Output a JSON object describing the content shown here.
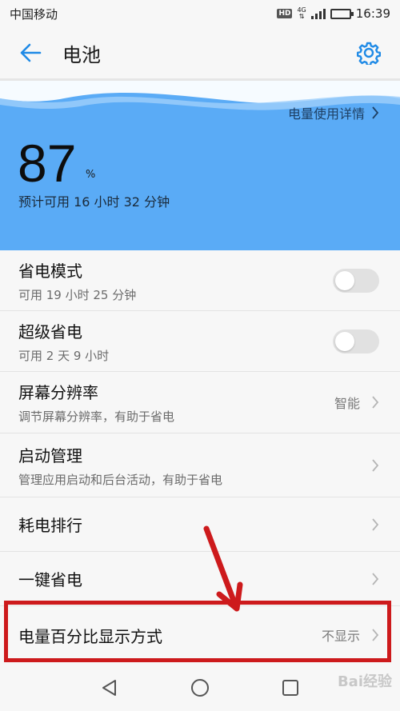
{
  "status_bar": {
    "carrier": "中国移动",
    "hd": "HD",
    "network": "4G",
    "time": "16:39"
  },
  "app_bar": {
    "title": "电池"
  },
  "battery": {
    "percent": "87",
    "percent_unit": "%",
    "remaining": "预计可用 16 小时 32 分钟",
    "detail_link": "电量使用详情",
    "level_fraction": 0.87,
    "hero_color": "#5aabf6"
  },
  "settings": [
    {
      "label": "省电模式",
      "sub": "可用 19 小时 25 分钟",
      "control": "toggle",
      "on": false
    },
    {
      "label": "超级省电",
      "sub": "可用 2 天 9 小时",
      "control": "toggle",
      "on": false
    },
    {
      "label": "屏幕分辨率",
      "sub": "调节屏幕分辨率，有助于省电",
      "value": "智能",
      "control": "chevron"
    },
    {
      "label": "启动管理",
      "sub": "管理应用启动和后台活动，有助于省电",
      "control": "chevron"
    },
    {
      "label": "耗电排行",
      "control": "chevron"
    },
    {
      "label": "一键省电",
      "control": "chevron"
    },
    {
      "label": "电量百分比显示方式",
      "value": "不显示",
      "control": "chevron"
    }
  ],
  "annotation": {
    "color": "#cd1a1c"
  },
  "nav_bar": {
    "icons": [
      "back-triangle-icon",
      "home-circle-icon",
      "recents-square-icon"
    ]
  },
  "watermark": "Bai经验"
}
